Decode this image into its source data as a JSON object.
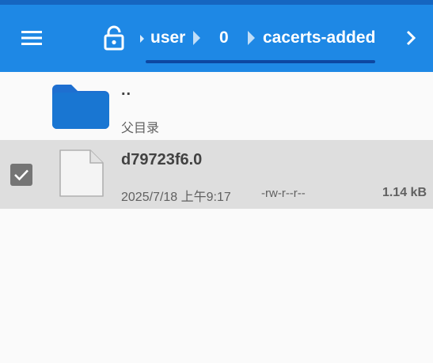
{
  "appbar": {
    "background": "#1e88e5",
    "menu_icon": "hamburger-menu-icon",
    "lock_icon": "unlock-icon",
    "more_icon": "chevron-right-icon",
    "breadcrumb": [
      "user",
      "0",
      "cacerts-added"
    ]
  },
  "list": {
    "parent": {
      "name": "..",
      "subtitle": "父目录",
      "icon": "folder-icon"
    },
    "files": [
      {
        "name": "d79723f6.0",
        "date": "2025/7/18 上午9:17",
        "permissions": "-rw-r--r--",
        "size": "1.14 kB",
        "icon": "file-icon",
        "selected": true
      }
    ]
  }
}
